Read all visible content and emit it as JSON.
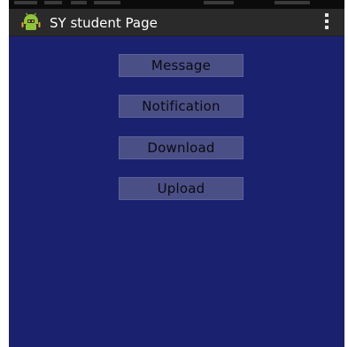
{
  "app_bar": {
    "title": "SY student Page",
    "icon": "android-robot-icon",
    "menu_icon": "overflow-menu-icon"
  },
  "buttons": {
    "message": "Message",
    "notification": "Notification",
    "download": "Download",
    "upload": "Upload"
  },
  "colors": {
    "background": "#1a2270",
    "action_bar": "#2a2a2a",
    "button": "#4a4f86",
    "button_text": "#0b0b12",
    "title_text": "#ffffff"
  }
}
